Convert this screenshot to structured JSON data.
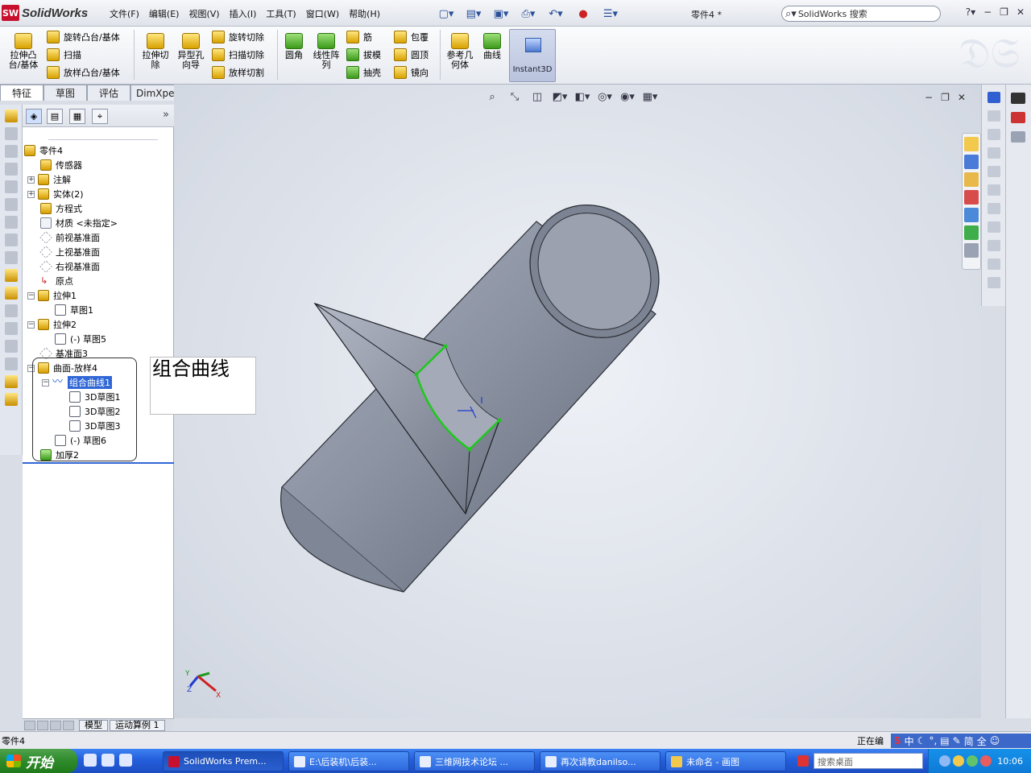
{
  "app": {
    "name": "SolidWorks",
    "doc_title": "零件4 *",
    "search_placeholder": "SolidWorks 搜索"
  },
  "menu": [
    "文件(F)",
    "编辑(E)",
    "视图(V)",
    "插入(I)",
    "工具(T)",
    "窗口(W)",
    "帮助(H)"
  ],
  "commands": {
    "extrude_boss": "拉伸凸\n台/基体",
    "revolve_boss": "旋转凸台/基体",
    "sweep": "扫描",
    "loft_boss": "放样凸台/基体",
    "extrude_cut": "拉伸切\n除",
    "hole_wizard": "异型孔\n向导",
    "revolve_cut": "旋转切除",
    "swept_cut": "扫描切除",
    "lofted_cut": "放样切割",
    "fillet": "圆角",
    "linear_pattern": "线性阵\n列",
    "rib": "筋",
    "draft": "拔模",
    "shell": "抽壳",
    "wrap": "包覆",
    "dome": "圆顶",
    "mirror": "镜向",
    "ref_geometry": "参考几\n何体",
    "curves": "曲线",
    "instant3d": "Instant3D"
  },
  "tabs": [
    "特征",
    "草图",
    "评估",
    "DimXpert"
  ],
  "tree": {
    "root": "零件4",
    "items": [
      {
        "label": "传感器"
      },
      {
        "label": "注解"
      },
      {
        "label": "实体(2)"
      },
      {
        "label": "方程式"
      },
      {
        "label": "材质 <未指定>"
      },
      {
        "label": "前视基准面"
      },
      {
        "label": "上视基准面"
      },
      {
        "label": "右视基准面"
      },
      {
        "label": "原点"
      },
      {
        "label": "拉伸1"
      },
      {
        "label": "草图1"
      },
      {
        "label": "拉伸2"
      },
      {
        "label": "(-) 草图5"
      },
      {
        "label": "基准面3"
      },
      {
        "label": "曲面-放样4"
      },
      {
        "label": "组合曲线1"
      },
      {
        "label": "3D草图1"
      },
      {
        "label": "3D草图2"
      },
      {
        "label": "3D草图3"
      },
      {
        "label": "(-) 草图6"
      },
      {
        "label": "加厚2"
      }
    ]
  },
  "tooltip": "组合曲线",
  "fm_bottom_tabs": [
    "模型",
    "运动算例 1"
  ],
  "triad": {
    "x": "X",
    "y": "Y",
    "z": "Z"
  },
  "status": {
    "left": "零件4",
    "right": "正在编"
  },
  "ime": [
    "中",
    "简",
    "全"
  ],
  "taskbar": {
    "start": "开始",
    "buttons": [
      "SolidWorks Prem...",
      "E:\\后装机\\后装...",
      "三维网技术论坛 ...",
      "再次请教danilso...",
      "未命名 - 画图"
    ],
    "desk_search": "搜索桌面",
    "clock": "10:06"
  },
  "colors": {
    "model_fill": "#8a919f",
    "highlight_green": "#1ec81e",
    "selection_blue": "#3067d6"
  }
}
